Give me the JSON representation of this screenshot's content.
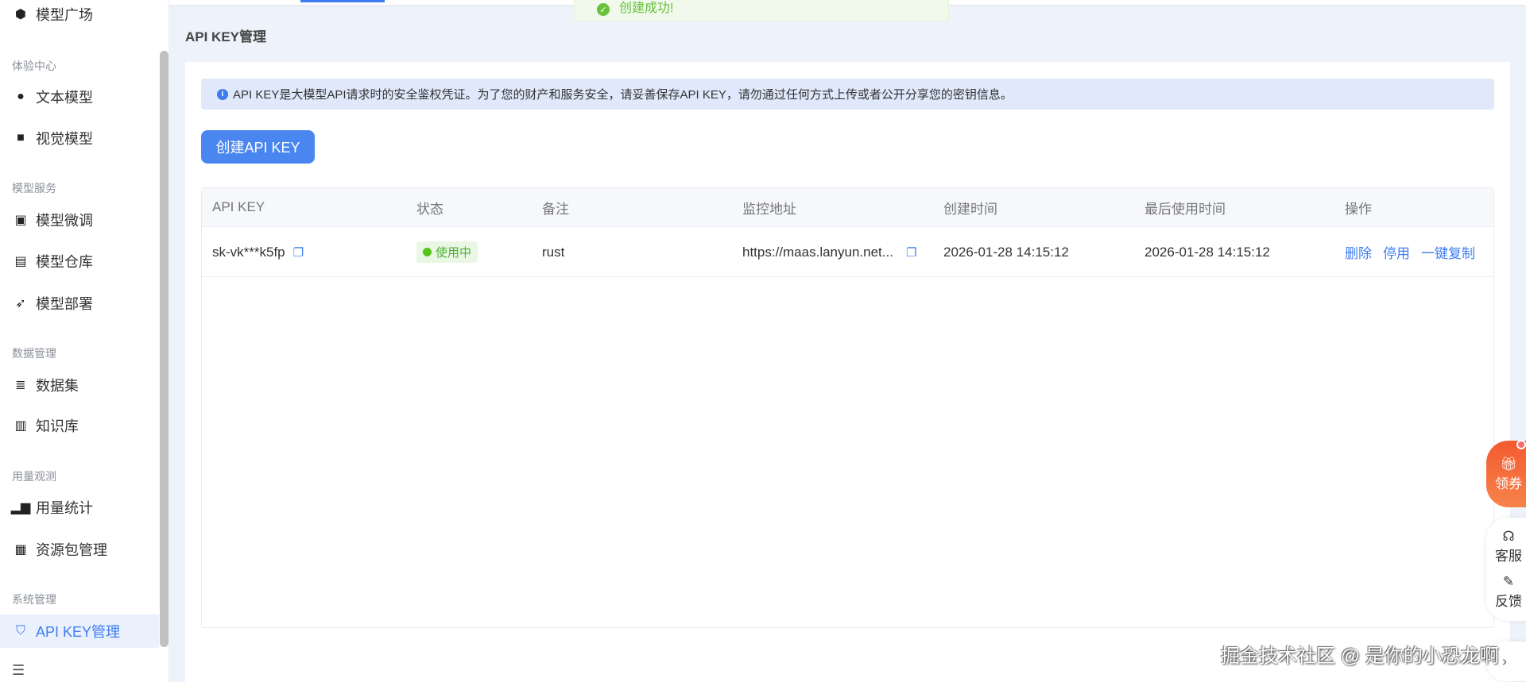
{
  "toast": {
    "message": "创建成功!"
  },
  "sidebar": {
    "items": [
      {
        "type": "item",
        "label": "模型广场",
        "icon": "cube-icon"
      },
      {
        "type": "group",
        "label": "体验中心"
      },
      {
        "type": "item",
        "label": "文本模型",
        "icon": "chat-icon"
      },
      {
        "type": "item",
        "label": "视觉模型",
        "icon": "camera-icon"
      },
      {
        "type": "group",
        "label": "模型服务"
      },
      {
        "type": "item",
        "label": "模型微调",
        "icon": "sliders-icon"
      },
      {
        "type": "item",
        "label": "模型仓库",
        "icon": "archive-icon"
      },
      {
        "type": "item",
        "label": "模型部署",
        "icon": "rocket-icon"
      },
      {
        "type": "group",
        "label": "数据管理"
      },
      {
        "type": "item",
        "label": "数据集",
        "icon": "database-icon"
      },
      {
        "type": "item",
        "label": "知识库",
        "icon": "book-icon"
      },
      {
        "type": "group",
        "label": "用量观测"
      },
      {
        "type": "item",
        "label": "用量统计",
        "icon": "bar-chart-icon"
      },
      {
        "type": "item",
        "label": "资源包管理",
        "icon": "gift-icon"
      },
      {
        "type": "group",
        "label": "系统管理"
      },
      {
        "type": "item",
        "label": "API KEY管理",
        "icon": "shield-icon",
        "active": true
      }
    ]
  },
  "page": {
    "title": "API KEY管理",
    "notice": "API KEY是大模型API请求时的安全鉴权凭证。为了您的财产和服务安全，请妥善保存API KEY，请勿通过任何方式上传或者公开分享您的密钥信息。",
    "create_button": "创建API KEY"
  },
  "table": {
    "headers": [
      "API KEY",
      "状态",
      "备注",
      "监控地址",
      "创建时间",
      "最后使用时间",
      "操作"
    ],
    "rows": [
      {
        "key": "sk-vk***k5fp",
        "status": "使用中",
        "remark": "rust",
        "url": "https://maas.lanyun.net...",
        "created": "2026-01-28 14:15:12",
        "last_used": "2026-01-28 14:15:12",
        "actions": [
          "删除",
          "停用",
          "一键复制"
        ]
      }
    ]
  },
  "float": {
    "coupon": "领券",
    "service": "客服",
    "feedback": "反馈"
  },
  "watermark": "掘金技术社区 @ 是你的小恐龙啊"
}
